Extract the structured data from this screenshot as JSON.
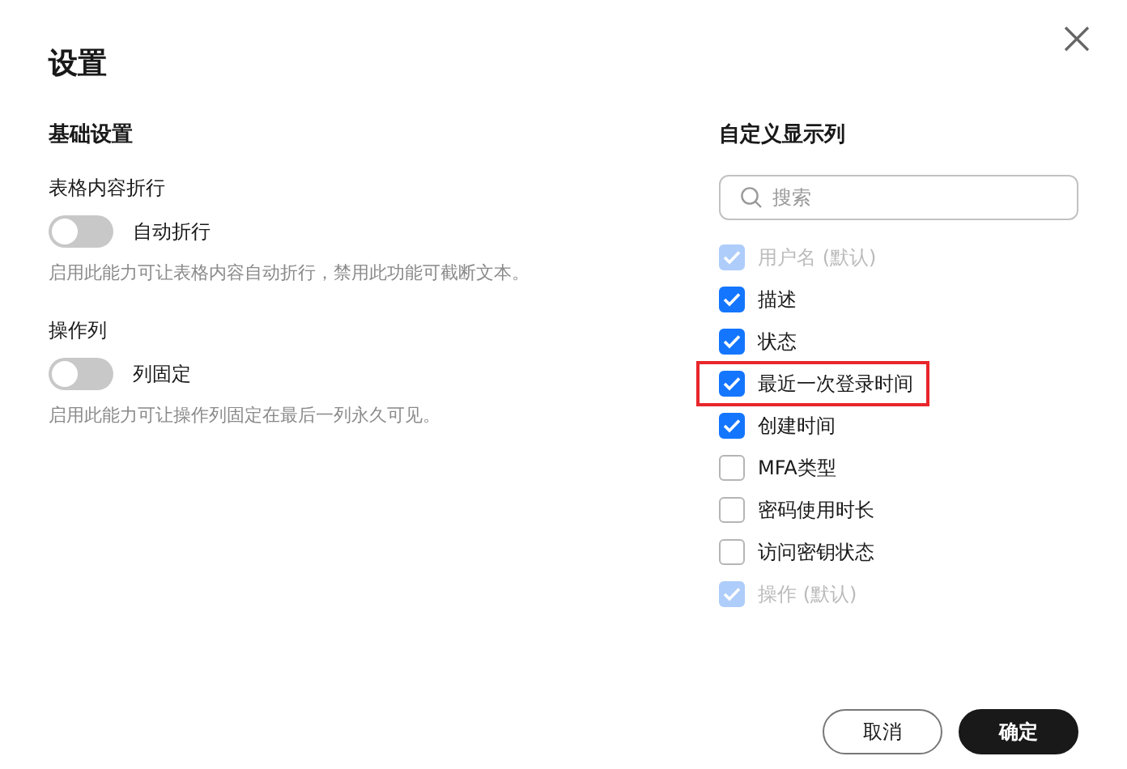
{
  "dialog": {
    "title": "设置"
  },
  "basic": {
    "heading": "基础设置",
    "settings": [
      {
        "label": "表格内容折行",
        "switch_label": "自动折行",
        "on": false,
        "description": "启用此能力可让表格内容自动折行，禁用此功能可截断文本。"
      },
      {
        "label": "操作列",
        "switch_label": "列固定",
        "on": false,
        "description": "启用此能力可让操作列固定在最后一列永久可见。"
      }
    ]
  },
  "columns": {
    "heading": "自定义显示列",
    "search": {
      "placeholder": "搜索"
    },
    "items": [
      {
        "label": "用户名 (默认)",
        "checked": true,
        "disabled": true,
        "highlighted": false
      },
      {
        "label": "描述",
        "checked": true,
        "disabled": false,
        "highlighted": false
      },
      {
        "label": "状态",
        "checked": true,
        "disabled": false,
        "highlighted": false
      },
      {
        "label": "最近一次登录时间",
        "checked": true,
        "disabled": false,
        "highlighted": true
      },
      {
        "label": "创建时间",
        "checked": true,
        "disabled": false,
        "highlighted": false
      },
      {
        "label": "MFA类型",
        "checked": false,
        "disabled": false,
        "highlighted": false
      },
      {
        "label": "密码使用时长",
        "checked": false,
        "disabled": false,
        "highlighted": false
      },
      {
        "label": "访问密钥状态",
        "checked": false,
        "disabled": false,
        "highlighted": false
      },
      {
        "label": "操作 (默认)",
        "checked": true,
        "disabled": true,
        "highlighted": false
      }
    ]
  },
  "buttons": [
    {
      "label": "取消",
      "kind": "secondary"
    },
    {
      "label": "确定",
      "kind": "primary"
    }
  ]
}
